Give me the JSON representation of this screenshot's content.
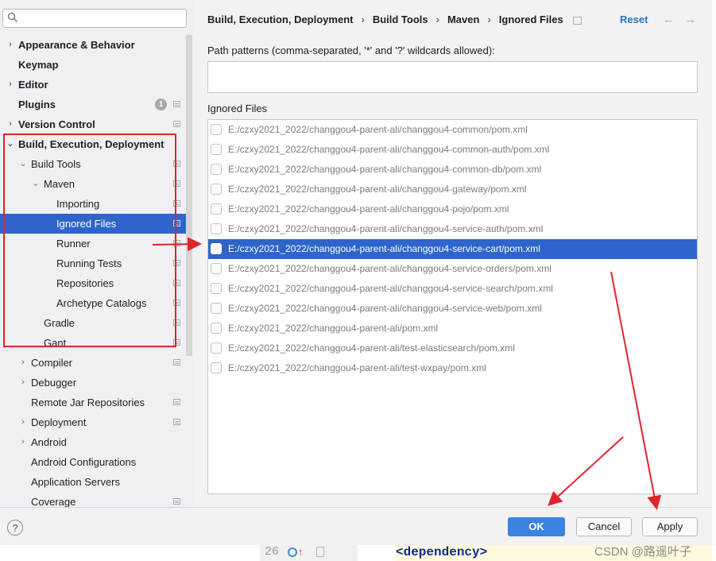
{
  "search": {
    "placeholder": ""
  },
  "sidebar": {
    "items": [
      {
        "label": "Appearance & Behavior",
        "arrow": "›",
        "bold": true
      },
      {
        "label": "Keymap",
        "arrow": "",
        "bold": true
      },
      {
        "label": "Editor",
        "arrow": "›",
        "bold": true
      },
      {
        "label": "Plugins",
        "arrow": "",
        "bold": true,
        "badge": "1"
      },
      {
        "label": "Version Control",
        "arrow": "›",
        "bold": true
      },
      {
        "label": "Build, Execution, Deployment",
        "arrow": "⌄",
        "bold": true
      },
      {
        "label": "Build Tools",
        "arrow": "⌄"
      },
      {
        "label": "Maven",
        "arrow": "⌄"
      },
      {
        "label": "Importing",
        "arrow": ""
      },
      {
        "label": "Ignored Files",
        "arrow": "",
        "selected": true
      },
      {
        "label": "Runner",
        "arrow": ""
      },
      {
        "label": "Running Tests",
        "arrow": ""
      },
      {
        "label": "Repositories",
        "arrow": ""
      },
      {
        "label": "Archetype Catalogs",
        "arrow": ""
      },
      {
        "label": "Gradle",
        "arrow": ""
      },
      {
        "label": "Gant",
        "arrow": ""
      },
      {
        "label": "Compiler",
        "arrow": "›"
      },
      {
        "label": "Debugger",
        "arrow": "›"
      },
      {
        "label": "Remote Jar Repositories",
        "arrow": ""
      },
      {
        "label": "Deployment",
        "arrow": "›"
      },
      {
        "label": "Android",
        "arrow": "›"
      },
      {
        "label": "Android Configurations",
        "arrow": ""
      },
      {
        "label": "Application Servers",
        "arrow": ""
      },
      {
        "label": "Coverage",
        "arrow": ""
      }
    ]
  },
  "breadcrumb": [
    "Build, Execution, Deployment",
    "Build Tools",
    "Maven",
    "Ignored Files"
  ],
  "header": {
    "reset": "Reset",
    "back": "←",
    "forward": "→"
  },
  "path_patterns": {
    "label": "Path patterns (comma-separated, '*' and '?' wildcards allowed):",
    "value": ""
  },
  "ignored_files": {
    "label": "Ignored Files",
    "files": [
      "E:/czxy2021_2022/changgou4-parent-ali/changgou4-common/pom.xml",
      "E:/czxy2021_2022/changgou4-parent-ali/changgou4-common-auth/pom.xml",
      "E:/czxy2021_2022/changgou4-parent-ali/changgou4-common-db/pom.xml",
      "E:/czxy2021_2022/changgou4-parent-ali/changgou4-gateway/pom.xml",
      "E:/czxy2021_2022/changgou4-parent-ali/changgou4-pojo/pom.xml",
      "E:/czxy2021_2022/changgou4-parent-ali/changgou4-service-auth/pom.xml",
      "E:/czxy2021_2022/changgou4-parent-ali/changgou4-service-cart/pom.xml",
      "E:/czxy2021_2022/changgou4-parent-ali/changgou4-service-orders/pom.xml",
      "E:/czxy2021_2022/changgou4-parent-ali/changgou4-service-search/pom.xml",
      "E:/czxy2021_2022/changgou4-parent-ali/changgou4-service-web/pom.xml",
      "E:/czxy2021_2022/changgou4-parent-ali/pom.xml",
      "E:/czxy2021_2022/changgou4-parent-ali/test-elasticsearch/pom.xml",
      "E:/czxy2021_2022/changgou4-parent-ali/test-wxpay/pom.xml"
    ],
    "selected_index": 6
  },
  "footer": {
    "help": "?",
    "ok": "OK",
    "cancel": "Cancel",
    "apply": "Apply"
  },
  "editor": {
    "line_number": "26",
    "code": "<dependency>"
  },
  "watermark": "CSDN @路遥叶子",
  "colors": {
    "selection": "#2f65ca",
    "annotation": "#e0242c",
    "link": "#2675bf"
  }
}
